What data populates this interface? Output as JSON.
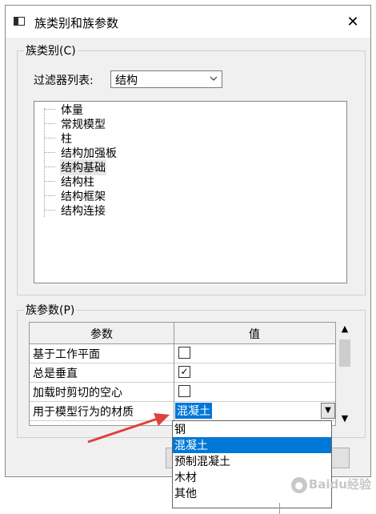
{
  "window": {
    "title": "族类别和族参数",
    "close_symbol": "✕"
  },
  "category_group": {
    "label": "族类别(C)",
    "filter_label": "过滤器列表:",
    "filter_value": "结构",
    "items": [
      "体量",
      "常规模型",
      "柱",
      "结构加强板",
      "结构基础",
      "结构柱",
      "结构框架",
      "结构连接"
    ],
    "selected": "结构基础"
  },
  "params_group": {
    "label": "族参数(P)",
    "columns": [
      "参数",
      "值"
    ],
    "rows": [
      {
        "name": "基于工作平面",
        "checked": false
      },
      {
        "name": "总是垂直",
        "checked": true
      },
      {
        "name": "加载时剪切的空心",
        "checked": false
      },
      {
        "name": "用于模型行为的材质",
        "value": "混凝土"
      }
    ],
    "material_options": [
      "钢",
      "混凝土",
      "预制混凝土",
      "木材",
      "其他"
    ],
    "material_selected": "混凝土"
  },
  "watermark": {
    "text": "Baidu经验",
    "icon": "baidu-paw-icon"
  },
  "colors": {
    "selection": "#0078d7",
    "annotation_arrow": "#e0413a"
  }
}
